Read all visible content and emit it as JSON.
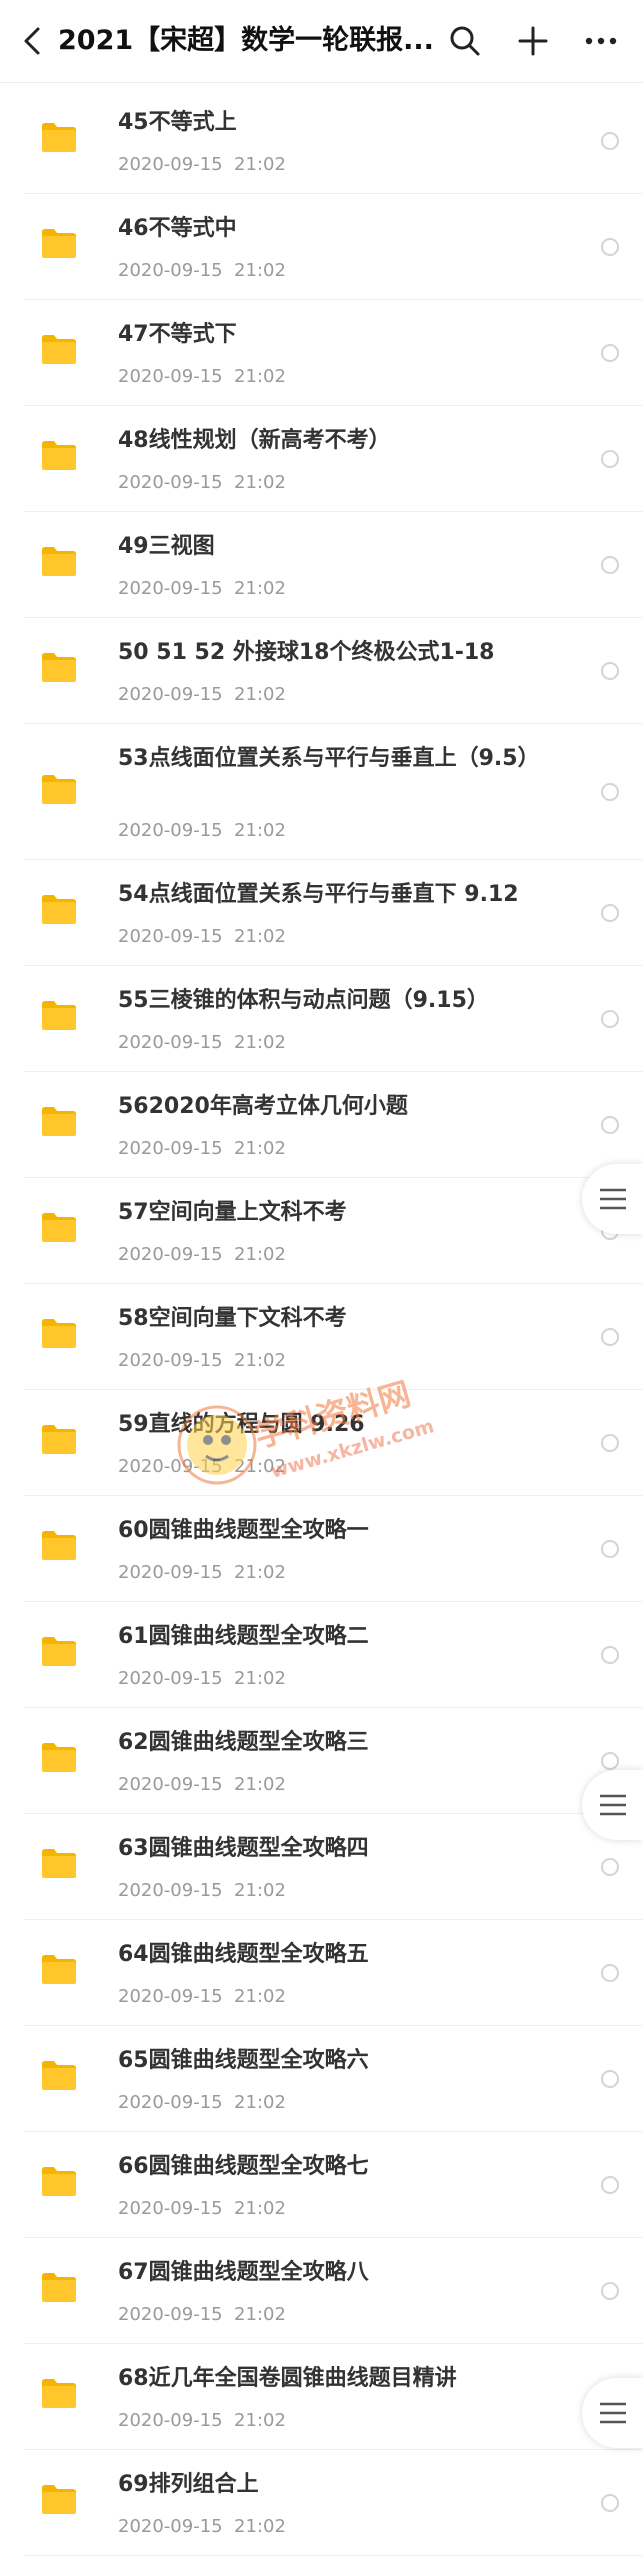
{
  "header": {
    "title": "2021【宋超】数学一轮联报...",
    "back_icon": "back-arrow-icon",
    "search_icon": "search-icon",
    "add_icon": "plus-icon",
    "more_icon": "more-icon"
  },
  "colors": {
    "folder": "#FFC72C",
    "date": "#9a9a9a",
    "watermark": "#F07A3C"
  },
  "list": {
    "items": [
      {
        "name": "45不等式上",
        "date": "2020-09-15  21:02"
      },
      {
        "name": "46不等式中",
        "date": "2020-09-15  21:02"
      },
      {
        "name": "47不等式下",
        "date": "2020-09-15  21:02"
      },
      {
        "name": "48线性规划（新高考不考）",
        "date": "2020-09-15  21:02"
      },
      {
        "name": "49三视图",
        "date": "2020-09-15  21:02"
      },
      {
        "name": "50 51 52 外接球18个终极公式1-18",
        "date": "2020-09-15  21:02"
      },
      {
        "name": "53点线面位置关系与平行与垂直上（9.5）",
        "date": "2020-09-15  21:02"
      },
      {
        "name": "54点线面位置关系与平行与垂直下 9.12",
        "date": "2020-09-15  21:02"
      },
      {
        "name": "55三棱锥的体积与动点问题（9.15）",
        "date": "2020-09-15  21:02"
      },
      {
        "name": "562020年高考立体几何小题",
        "date": "2020-09-15  21:02"
      },
      {
        "name": "57空间向量上文科不考",
        "date": "2020-09-15  21:02"
      },
      {
        "name": "58空间向量下文科不考",
        "date": "2020-09-15  21:02"
      },
      {
        "name": "59直线的方程与圆 9.26",
        "date": "2020-09-15  21:02"
      },
      {
        "name": "60圆锥曲线题型全攻略一",
        "date": "2020-09-15  21:02"
      },
      {
        "name": "61圆锥曲线题型全攻略二",
        "date": "2020-09-15  21:02"
      },
      {
        "name": "62圆锥曲线题型全攻略三",
        "date": "2020-09-15  21:02"
      },
      {
        "name": "63圆锥曲线题型全攻略四",
        "date": "2020-09-15  21:02"
      },
      {
        "name": "64圆锥曲线题型全攻略五",
        "date": "2020-09-15  21:02"
      },
      {
        "name": "65圆锥曲线题型全攻略六",
        "date": "2020-09-15  21:02"
      },
      {
        "name": "66圆锥曲线题型全攻略七",
        "date": "2020-09-15  21:02"
      },
      {
        "name": "67圆锥曲线题型全攻略八",
        "date": "2020-09-15  21:02"
      },
      {
        "name": "68近几年全国卷圆锥曲线题目精讲",
        "date": "2020-09-15  21:02"
      },
      {
        "name": "69排列组合上",
        "date": "2020-09-15  21:02"
      }
    ]
  },
  "floating_menu_icon": "menu-lines-icon",
  "watermark": {
    "main": "学科资料网",
    "sub": "www.xkzlw.com"
  }
}
